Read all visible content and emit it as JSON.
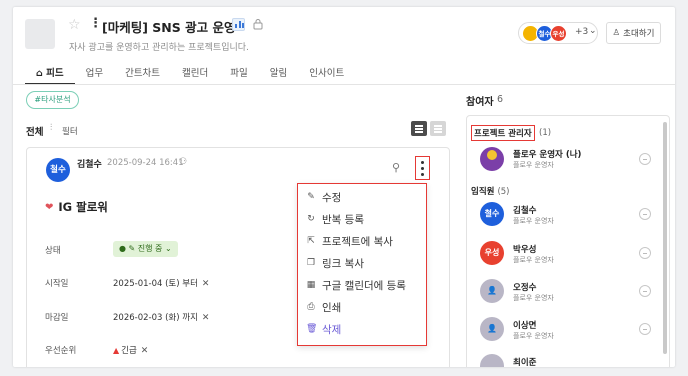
{
  "project": {
    "title": "[마케팅] SNS 광고 운영",
    "subtitle": "자사 광고를 운영하고 관리하는 프로젝트입니다.",
    "icons": [
      "star-icon",
      "kebab-icon",
      "chart-icon",
      "lock-icon"
    ]
  },
  "header": {
    "member_avatars": [
      "철수",
      "우성"
    ],
    "member_extra": "+3",
    "invite_label": "초대하기"
  },
  "tabs": [
    {
      "label": "피드",
      "active": true
    },
    {
      "label": "업무"
    },
    {
      "label": "간트차트"
    },
    {
      "label": "캘린더"
    },
    {
      "label": "파일"
    },
    {
      "label": "알림"
    },
    {
      "label": "인사이트"
    }
  ],
  "feed": {
    "tag": "#타사분석",
    "filter_scope": "전체",
    "filter_label": "필터"
  },
  "post": {
    "author_avatar": "철수",
    "author": "김철수",
    "date": "2025-09-24 16:41",
    "task_title": "IG 팔로워",
    "fields": {
      "status_label": "상태",
      "status_value": "진행 중",
      "start_label": "시작일",
      "start_value": "2025-01-04 (토) 부터",
      "due_label": "마감일",
      "due_value": "2026-02-03 (화) 까지",
      "priority_label": "우선순위",
      "priority_value": "긴급"
    }
  },
  "menu": [
    {
      "label": "수정",
      "icon": "pencil-icon"
    },
    {
      "label": "반복 등록",
      "icon": "repeat-icon"
    },
    {
      "label": "프로젝트에 복사",
      "icon": "copy-to-project-icon"
    },
    {
      "label": "링크 복사",
      "icon": "link-copy-icon"
    },
    {
      "label": "구글 캘린더에 등록",
      "icon": "calendar-icon"
    },
    {
      "label": "인쇄",
      "icon": "print-icon"
    },
    {
      "label": "삭제",
      "icon": "trash-icon",
      "danger": true
    }
  ],
  "participants": {
    "title": "참여자",
    "count": "6",
    "admins_label": "프로젝트 관리자",
    "admins_count": "(1)",
    "admins": [
      {
        "name": "플로우 운영자 (나)",
        "role": "플로우 운영자"
      }
    ],
    "members_label": "임직원",
    "members_count": "(5)",
    "members": [
      {
        "avatar": "철수",
        "name": "김철수",
        "role": "플로우 운영자",
        "color": "#1e5fdc"
      },
      {
        "avatar": "우성",
        "name": "박우성",
        "role": "플로우 운영자",
        "color": "#e8412f"
      },
      {
        "avatar": "",
        "name": "오정수",
        "role": "플로우 운영자",
        "color": "#b9b6c6"
      },
      {
        "avatar": "",
        "name": "이상면",
        "role": "플로우 운영자",
        "color": "#b9b6c6"
      },
      {
        "avatar": "",
        "name": "최이준",
        "role": "",
        "color": "#b9b6c6"
      }
    ]
  },
  "colors": {
    "accent_red": "#e53935",
    "brand_blue": "#1e5fdc",
    "status_green_bg": "#e1f2d7",
    "tag_green": "#2a9d7c",
    "delete_purple": "#6b5bd6"
  }
}
